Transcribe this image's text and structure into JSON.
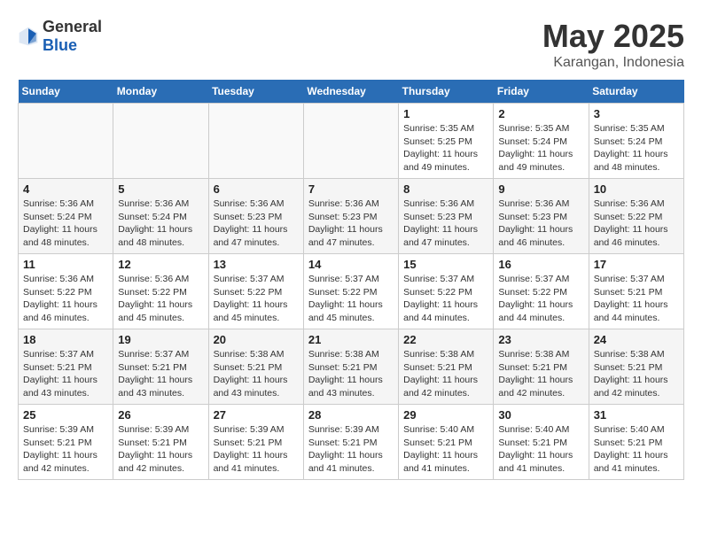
{
  "logo": {
    "general": "General",
    "blue": "Blue"
  },
  "title": "May 2025",
  "location": "Karangan, Indonesia",
  "days_header": [
    "Sunday",
    "Monday",
    "Tuesday",
    "Wednesday",
    "Thursday",
    "Friday",
    "Saturday"
  ],
  "weeks": [
    [
      {
        "day": "",
        "info": ""
      },
      {
        "day": "",
        "info": ""
      },
      {
        "day": "",
        "info": ""
      },
      {
        "day": "",
        "info": ""
      },
      {
        "day": "1",
        "info": "Sunrise: 5:35 AM\nSunset: 5:25 PM\nDaylight: 11 hours\nand 49 minutes."
      },
      {
        "day": "2",
        "info": "Sunrise: 5:35 AM\nSunset: 5:24 PM\nDaylight: 11 hours\nand 49 minutes."
      },
      {
        "day": "3",
        "info": "Sunrise: 5:35 AM\nSunset: 5:24 PM\nDaylight: 11 hours\nand 48 minutes."
      }
    ],
    [
      {
        "day": "4",
        "info": "Sunrise: 5:36 AM\nSunset: 5:24 PM\nDaylight: 11 hours\nand 48 minutes."
      },
      {
        "day": "5",
        "info": "Sunrise: 5:36 AM\nSunset: 5:24 PM\nDaylight: 11 hours\nand 48 minutes."
      },
      {
        "day": "6",
        "info": "Sunrise: 5:36 AM\nSunset: 5:23 PM\nDaylight: 11 hours\nand 47 minutes."
      },
      {
        "day": "7",
        "info": "Sunrise: 5:36 AM\nSunset: 5:23 PM\nDaylight: 11 hours\nand 47 minutes."
      },
      {
        "day": "8",
        "info": "Sunrise: 5:36 AM\nSunset: 5:23 PM\nDaylight: 11 hours\nand 47 minutes."
      },
      {
        "day": "9",
        "info": "Sunrise: 5:36 AM\nSunset: 5:23 PM\nDaylight: 11 hours\nand 46 minutes."
      },
      {
        "day": "10",
        "info": "Sunrise: 5:36 AM\nSunset: 5:22 PM\nDaylight: 11 hours\nand 46 minutes."
      }
    ],
    [
      {
        "day": "11",
        "info": "Sunrise: 5:36 AM\nSunset: 5:22 PM\nDaylight: 11 hours\nand 46 minutes."
      },
      {
        "day": "12",
        "info": "Sunrise: 5:36 AM\nSunset: 5:22 PM\nDaylight: 11 hours\nand 45 minutes."
      },
      {
        "day": "13",
        "info": "Sunrise: 5:37 AM\nSunset: 5:22 PM\nDaylight: 11 hours\nand 45 minutes."
      },
      {
        "day": "14",
        "info": "Sunrise: 5:37 AM\nSunset: 5:22 PM\nDaylight: 11 hours\nand 45 minutes."
      },
      {
        "day": "15",
        "info": "Sunrise: 5:37 AM\nSunset: 5:22 PM\nDaylight: 11 hours\nand 44 minutes."
      },
      {
        "day": "16",
        "info": "Sunrise: 5:37 AM\nSunset: 5:22 PM\nDaylight: 11 hours\nand 44 minutes."
      },
      {
        "day": "17",
        "info": "Sunrise: 5:37 AM\nSunset: 5:21 PM\nDaylight: 11 hours\nand 44 minutes."
      }
    ],
    [
      {
        "day": "18",
        "info": "Sunrise: 5:37 AM\nSunset: 5:21 PM\nDaylight: 11 hours\nand 43 minutes."
      },
      {
        "day": "19",
        "info": "Sunrise: 5:37 AM\nSunset: 5:21 PM\nDaylight: 11 hours\nand 43 minutes."
      },
      {
        "day": "20",
        "info": "Sunrise: 5:38 AM\nSunset: 5:21 PM\nDaylight: 11 hours\nand 43 minutes."
      },
      {
        "day": "21",
        "info": "Sunrise: 5:38 AM\nSunset: 5:21 PM\nDaylight: 11 hours\nand 43 minutes."
      },
      {
        "day": "22",
        "info": "Sunrise: 5:38 AM\nSunset: 5:21 PM\nDaylight: 11 hours\nand 42 minutes."
      },
      {
        "day": "23",
        "info": "Sunrise: 5:38 AM\nSunset: 5:21 PM\nDaylight: 11 hours\nand 42 minutes."
      },
      {
        "day": "24",
        "info": "Sunrise: 5:38 AM\nSunset: 5:21 PM\nDaylight: 11 hours\nand 42 minutes."
      }
    ],
    [
      {
        "day": "25",
        "info": "Sunrise: 5:39 AM\nSunset: 5:21 PM\nDaylight: 11 hours\nand 42 minutes."
      },
      {
        "day": "26",
        "info": "Sunrise: 5:39 AM\nSunset: 5:21 PM\nDaylight: 11 hours\nand 42 minutes."
      },
      {
        "day": "27",
        "info": "Sunrise: 5:39 AM\nSunset: 5:21 PM\nDaylight: 11 hours\nand 41 minutes."
      },
      {
        "day": "28",
        "info": "Sunrise: 5:39 AM\nSunset: 5:21 PM\nDaylight: 11 hours\nand 41 minutes."
      },
      {
        "day": "29",
        "info": "Sunrise: 5:40 AM\nSunset: 5:21 PM\nDaylight: 11 hours\nand 41 minutes."
      },
      {
        "day": "30",
        "info": "Sunrise: 5:40 AM\nSunset: 5:21 PM\nDaylight: 11 hours\nand 41 minutes."
      },
      {
        "day": "31",
        "info": "Sunrise: 5:40 AM\nSunset: 5:21 PM\nDaylight: 11 hours\nand 41 minutes."
      }
    ]
  ]
}
